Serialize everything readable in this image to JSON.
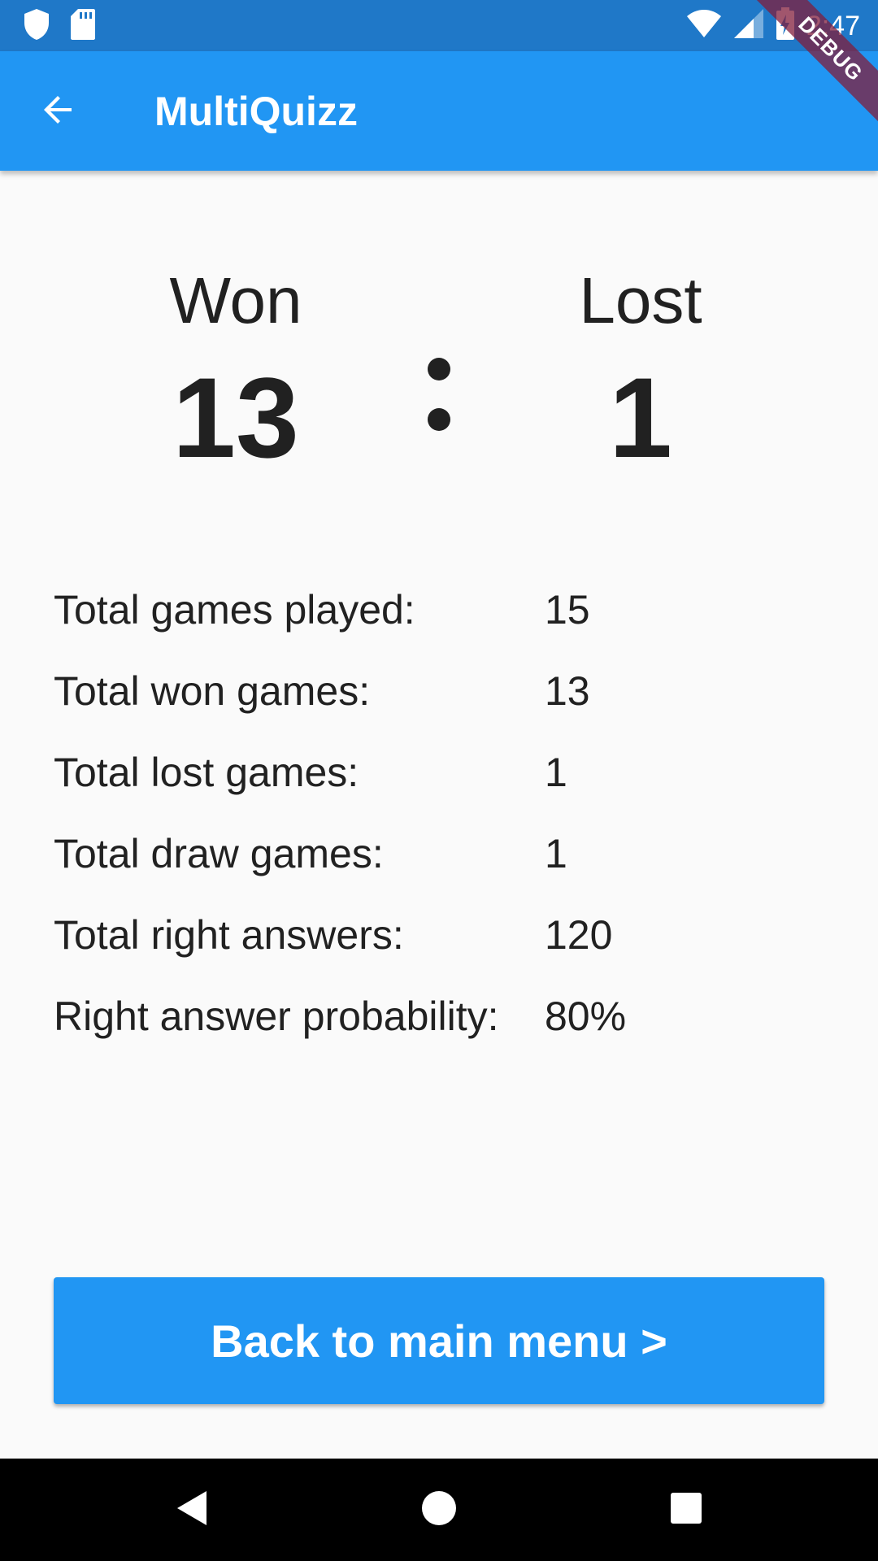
{
  "status_bar": {
    "time": "2:47",
    "icons": [
      "shield-icon",
      "sd-card-icon",
      "wifi-icon",
      "cell-signal-icon",
      "battery-charging-icon"
    ]
  },
  "debug_banner": {
    "label": "DEBUG"
  },
  "app_bar": {
    "title": "MultiQuizz",
    "back_icon": "arrow-back-icon"
  },
  "score": {
    "won_label": "Won",
    "won_value": "13",
    "lost_label": "Lost",
    "lost_value": "1"
  },
  "stats": [
    {
      "label": "Total games played:",
      "value": "15"
    },
    {
      "label": "Total won games:",
      "value": "13"
    },
    {
      "label": "Total lost games:",
      "value": "1"
    },
    {
      "label": "Total draw games:",
      "value": "1"
    },
    {
      "label": "Total right answers:",
      "value": "120"
    },
    {
      "label": "Right answer probability:",
      "value": "80%"
    }
  ],
  "main_button": {
    "label": "Back to main menu >"
  },
  "nav_bar": {
    "icons": [
      "nav-back-icon",
      "nav-home-icon",
      "nav-recents-icon"
    ]
  },
  "colors": {
    "status_bar": "#1f78c8",
    "app_bar": "#2196f3",
    "button": "#2196f3",
    "background": "#fafafa",
    "text": "#212121"
  }
}
